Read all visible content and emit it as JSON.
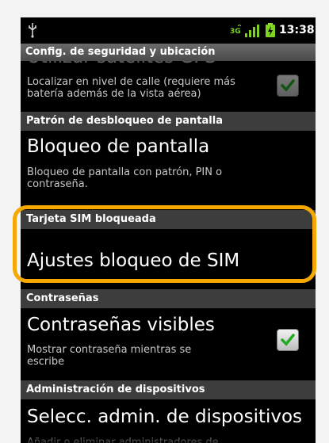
{
  "status_bar": {
    "time": "13:38",
    "usb_icon": "usb-icon",
    "data_icon": "3g-data-icon",
    "signal_icon": "signal-icon",
    "battery_icon": "battery-icon"
  },
  "title_bar": {
    "title": "Config. de seguridad y ubicación"
  },
  "items": {
    "gps": {
      "title": "Utilizar satélites GPS",
      "summary": "Localizar en nivel de calle (requiere más batería además de la vista aérea)",
      "checked": true
    },
    "screen_lock_header": "Patrón de desbloqueo de pantalla",
    "screen_lock": {
      "title": "Bloqueo de pantalla",
      "summary": "Bloqueo de pantalla con patrón, PIN o contraseña."
    },
    "sim_header": "Tarjeta SIM bloqueada",
    "sim_lock": {
      "title": "Ajustes bloqueo de SIM"
    },
    "passwords_header": "Contraseñas",
    "visible_passwords": {
      "title": "Contraseñas visibles",
      "summary": "Mostrar contraseña mientras se escribe",
      "checked": true
    },
    "device_admin_header": "Administración de dispositivos",
    "device_admin": {
      "title": "Selecc. admin. de dispositivos",
      "summary": "Añadir o eliminar administradores de dispositivos"
    }
  },
  "colors": {
    "highlight": "#f5a800",
    "check": "#22aa22"
  }
}
